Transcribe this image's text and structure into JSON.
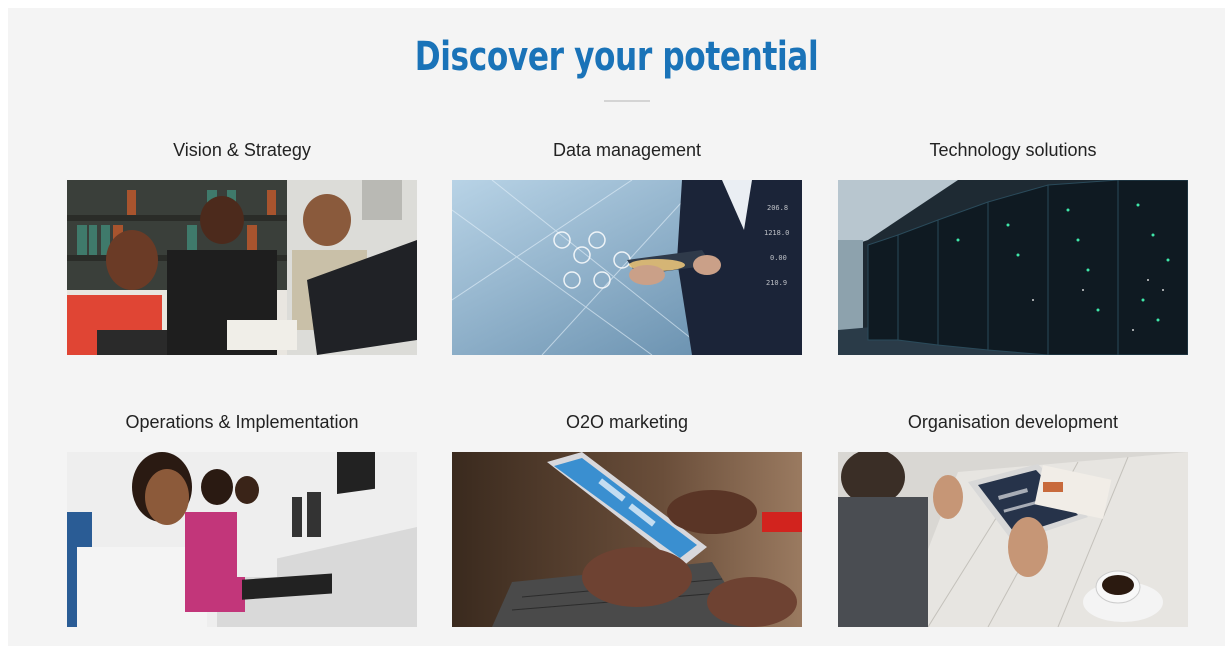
{
  "section": {
    "title": "Discover your potential"
  },
  "cards": [
    {
      "label": "Vision & Strategy",
      "image_icon": "team-at-computer-image"
    },
    {
      "label": "Data management",
      "image_icon": "tablet-data-image"
    },
    {
      "label": "Technology solutions",
      "image_icon": "server-room-image"
    },
    {
      "label": "Operations & Implementation",
      "image_icon": "call-center-image"
    },
    {
      "label": "O2O marketing",
      "image_icon": "smartphone-hands-image"
    },
    {
      "label": "Organisation development",
      "image_icon": "tablet-coffee-image"
    }
  ],
  "colors": {
    "accent": "#1a73b8",
    "background": "#f4f4f4"
  }
}
